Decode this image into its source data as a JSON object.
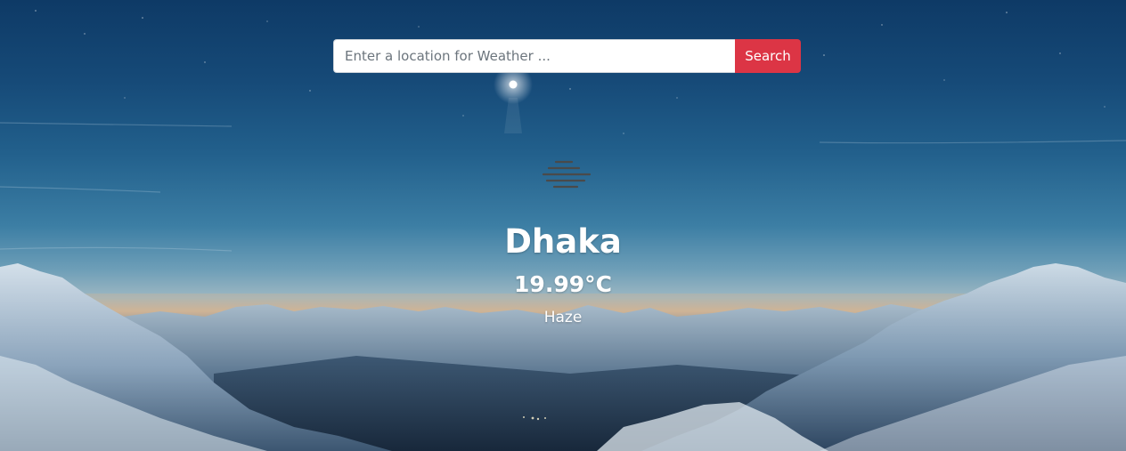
{
  "search": {
    "placeholder": "Enter a location for Weather ...",
    "button_label": "Search"
  },
  "weather": {
    "icon": "haze-icon",
    "city": "Dhaka",
    "temperature": "19.99°C",
    "condition": "Haze"
  },
  "colors": {
    "accent": "#dc3545",
    "text": "#ffffff",
    "icon": "#4a4a4a"
  }
}
